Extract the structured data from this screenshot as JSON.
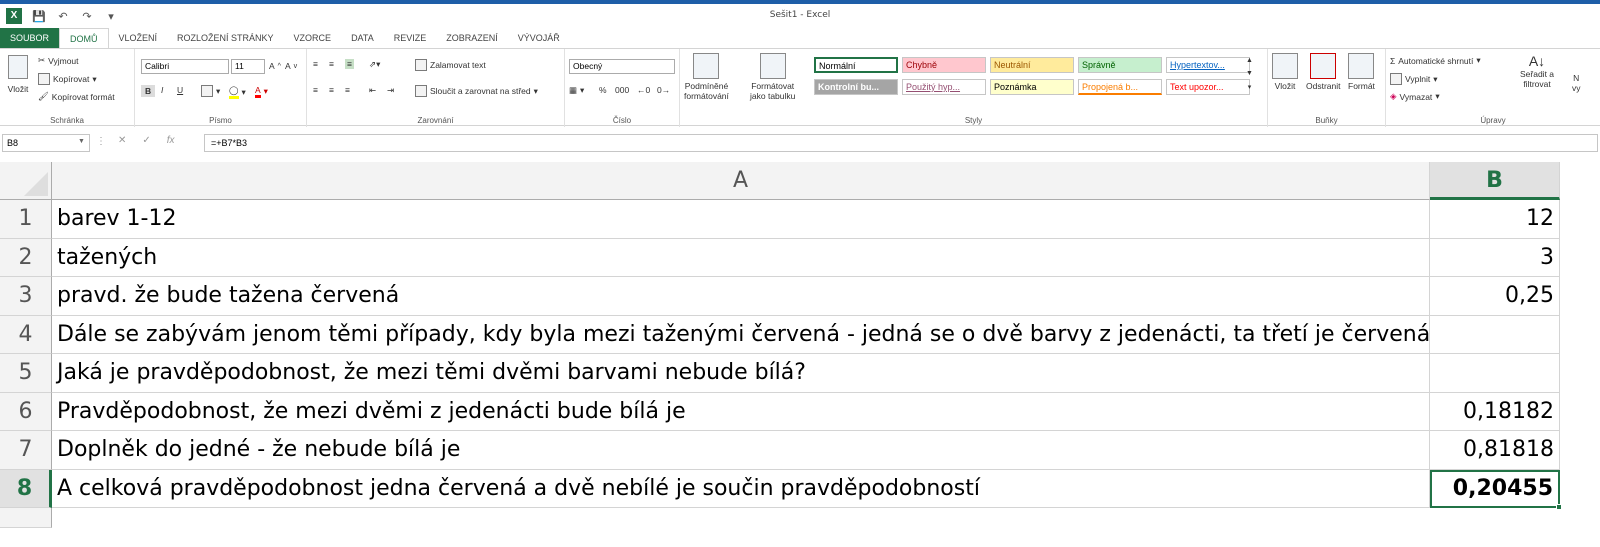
{
  "window": {
    "title": "Sešit1 - Excel"
  },
  "qat": {
    "logo": "X",
    "save_icon": "save-icon",
    "undo_icon": "undo-icon",
    "redo_icon": "redo-icon"
  },
  "menu": {
    "tabs": [
      "SOUBOR",
      "DOMŮ",
      "VLOŽENÍ",
      "ROZLOŽENÍ STRÁNKY",
      "VZORCE",
      "DATA",
      "REVIZE",
      "ZOBRAZENÍ",
      "VÝVOJÁŘ"
    ]
  },
  "ribbon": {
    "clipboard": {
      "label": "Schránka",
      "paste": "Vložit",
      "cut": "Vyjmout",
      "copy": "Kopírovat",
      "format_painter": "Kopírovat formát"
    },
    "font": {
      "label": "Písmo",
      "name": "Calibri",
      "size": "11",
      "bold": "B",
      "italic": "I",
      "underline": "U"
    },
    "alignment": {
      "label": "Zarovnání",
      "wrap": "Zalamovat text",
      "merge": "Sloučit a zarovnat na střed"
    },
    "number": {
      "label": "Číslo",
      "format": "Obecný",
      "percent": "%",
      "thousands": "000"
    },
    "styles": {
      "label": "Styly",
      "conditional": [
        "Podmíněné",
        "formátování"
      ],
      "format_table": [
        "Formátovat",
        "jako tabulku"
      ],
      "cells": [
        {
          "name": "Normální",
          "bg": "#ffffff",
          "fg": "#000000"
        },
        {
          "name": "Chybně",
          "bg": "#ffc7ce",
          "fg": "#9c0006"
        },
        {
          "name": "Neutrální",
          "bg": "#ffeb9c",
          "fg": "#9c5700"
        },
        {
          "name": "Správně",
          "bg": "#c6efce",
          "fg": "#006100"
        },
        {
          "name": "Hypertextov...",
          "bg": "#ffffff",
          "fg": "#0563c1"
        },
        {
          "name": "Kontrolní bu...",
          "bg": "#a5a5a5",
          "fg": "#ffffff"
        },
        {
          "name": "Použitý hyp...",
          "bg": "#ffffff",
          "fg": "#954f72"
        },
        {
          "name": "Poznámka",
          "bg": "#ffffcc",
          "fg": "#000000"
        },
        {
          "name": "Propojená b...",
          "bg": "#ffffff",
          "fg": "#fa7d00"
        },
        {
          "name": "Text upozor...",
          "bg": "#ffffff",
          "fg": "#ff0000"
        }
      ]
    },
    "cells_group": {
      "label": "Buňky",
      "insert": "Vložit",
      "delete": "Odstranit",
      "format": "Formát"
    },
    "editing": {
      "label": "Úpravy",
      "autosum": "Automatické shrnutí",
      "fill": "Vyplnit",
      "clear": "Vymazat",
      "sort": [
        "Seřadit a",
        "filtrovat"
      ],
      "find": [
        "N",
        "vy"
      ]
    }
  },
  "formula_bar": {
    "name_box": "B8",
    "formula": "=+B7*B3",
    "fx": "fx"
  },
  "sheet": {
    "columns": [
      "A",
      "B"
    ],
    "selected_cell": "B8",
    "rows": [
      {
        "n": "1",
        "a": "barev 1-12",
        "b": "12"
      },
      {
        "n": "2",
        "a": "tažených",
        "b": "3"
      },
      {
        "n": "3",
        "a": "pravd. že bude tažena červená",
        "b": "0,25"
      },
      {
        "n": "4",
        "a": "Dále se zabývám jenom těmi případy, kdy byla mezi taženými červená - jedná se o dvě barvy z jedenácti, ta třetí je červená",
        "b": ""
      },
      {
        "n": "5",
        "a": "Jaká je pravděpodobnost, že mezi těmi dvěmi barvami nebude bílá?",
        "b": ""
      },
      {
        "n": "6",
        "a": "Pravděpodobnost, že mezi dvěmi z jedenácti bude bílá je",
        "b": "0,18182"
      },
      {
        "n": "7",
        "a": "Doplněk do jedné - že nebude bílá je",
        "b": "0,81818"
      },
      {
        "n": "8",
        "a": "A celková pravděpodobnost jedna červená a dvě nebílé je součin pravděpodobností",
        "b": "0,20455"
      }
    ]
  },
  "colors": {
    "accent": "#217346",
    "titlebar": "#1e5ea8"
  }
}
